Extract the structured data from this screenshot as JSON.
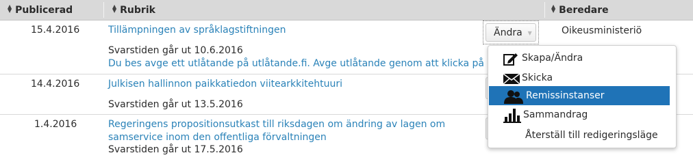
{
  "table": {
    "columns": [
      {
        "label": "Publicerad"
      },
      {
        "label": "Rubrik"
      },
      {
        "label": "Beredare"
      }
    ],
    "rows": [
      {
        "date": "15.4.2016",
        "title": "Tillämpningen av språklagstiftningen",
        "deadline": "Svarstiden går ut 10.6.2016",
        "note": "Du bes avge ett utlåtande på utlåtande.fi. Avge utlåtande genom att klicka på länk",
        "preparer": "Oikeusministeriö"
      },
      {
        "date": "14.4.2016",
        "title": "Julkisen hallinnon paikkatiedon viitearkkitehtuuri",
        "deadline": "Svarstiden går ut 13.5.2016"
      },
      {
        "date": "1.4.2016",
        "title_lines": [
          "Regeringens propositionsutkast till riksdagen om ändring av lagen om",
          "samservice inom den offentliga förvaltningen"
        ],
        "deadline": "Svarstiden går ut 17.5.2016"
      }
    ]
  },
  "action_button": {
    "label": "Ändra"
  },
  "menu": {
    "items": [
      {
        "label": "Skapa/Ändra",
        "icon": "edit-icon"
      },
      {
        "label": "Skicka",
        "icon": "envelope-icon"
      },
      {
        "label": "Remissinstanser",
        "icon": "users-icon",
        "active": true
      },
      {
        "label": "Sammandrag",
        "icon": "bar-chart-icon"
      },
      {
        "label": "Återställ till redigeringsläge",
        "icon": ""
      }
    ]
  },
  "colors": {
    "link": "#2a82b8",
    "header_bg": "#d9d9d9",
    "active_bg": "#1f73b7"
  }
}
